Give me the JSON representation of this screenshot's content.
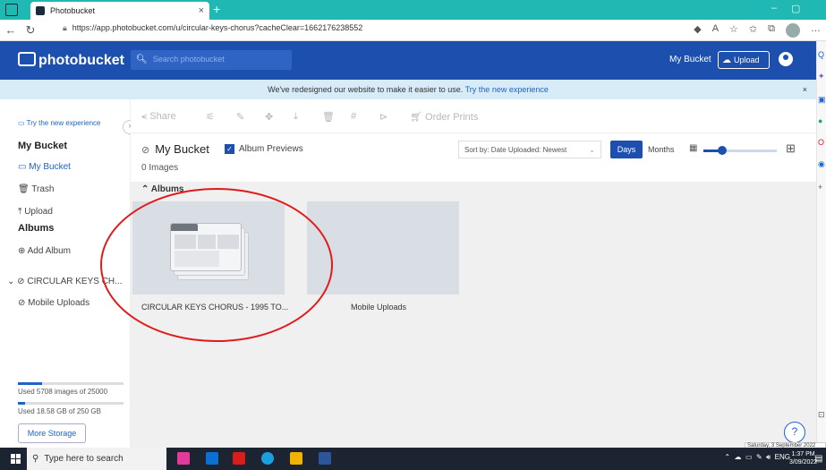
{
  "browser": {
    "tab_title": "Photobucket",
    "tab_close": "×",
    "new_tab": "+",
    "url": "https://app.photobucket.com/u/circular-keys-chorus?cacheClear=1662176238552",
    "window_controls": [
      "–",
      "▢"
    ]
  },
  "header": {
    "logo_text": "photobucket",
    "search_placeholder": "Search photobucket",
    "my_bucket": "My Bucket",
    "upload": "Upload"
  },
  "banner": {
    "text": "We've redesigned our website to make it easier to use.",
    "link": "Try the new experience",
    "close": "×"
  },
  "sidebar": {
    "try_new": "Try the new experience",
    "my_bucket_heading": "My Bucket",
    "my_bucket_link": "My Bucket",
    "trash": "Trash",
    "upload": "Upload",
    "albums_heading": "Albums",
    "add_album": "Add Album",
    "album_tree_root": "CIRCULAR KEYS CH...",
    "mobile_uploads": "Mobile Uploads",
    "usage_images": "Used 5708 images of 25000",
    "usage_images_fraction": 0.23,
    "usage_storage": "Used 18.58 GB of 250 GB",
    "usage_storage_fraction": 0.07,
    "more_storage": "More Storage"
  },
  "toolbar": {
    "share": "Share",
    "order_prints": "Order Prints"
  },
  "main": {
    "title": "My Bucket",
    "album_previews": "Album Previews",
    "album_previews_checked": true,
    "image_count": "0 Images",
    "sort": "Sort by: Date Uploaded: Newest",
    "days": "Days",
    "months": "Months",
    "zoom_fraction": 0.26,
    "albums_heading": "Albums",
    "albums": [
      {
        "label": "CIRCULAR KEYS CHORUS - 1995 TO..."
      },
      {
        "label": "Mobile Uploads"
      }
    ]
  },
  "help": "?",
  "tooltip": "Saturday, 3 September 2022",
  "taskbar": {
    "search_placeholder": "Type here to search",
    "lang": "ENG",
    "time": "1:37 PM",
    "date": "3/09/2022"
  },
  "colors": {
    "brand_blue": "#1d4fae",
    "tab_bar": "#1fb8b2",
    "annotation_red": "#e01b1b"
  }
}
